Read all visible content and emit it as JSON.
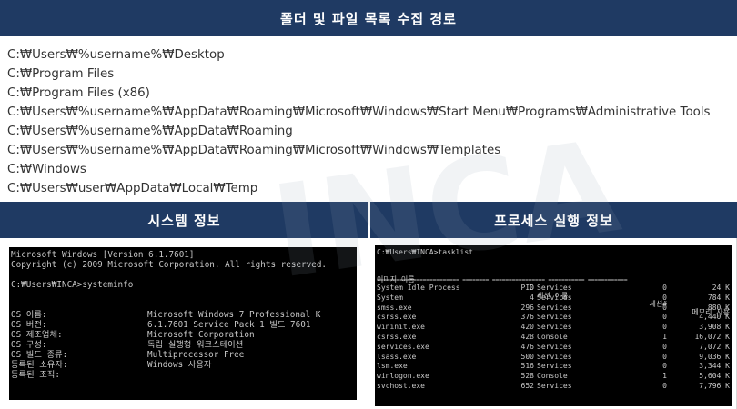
{
  "header": {
    "title": "폴더 및 파일 목록 수집 경로"
  },
  "paths": [
    "C:₩Users₩%username%₩Desktop",
    "C:₩Program Files",
    "C:₩Program Files (x86)",
    "C:₩Users₩%username%₩AppData₩Roaming₩Microsoft₩Windows₩Start Menu₩Programs₩Administrative Tools",
    "C:₩Users₩%username%₩AppData₩Roaming",
    "C:₩Users₩%username%₩AppData₩Roaming₩Microsoft₩Windows₩Templates",
    "C:₩Windows",
    "C:₩Users₩user₩AppData₩Local₩Temp"
  ],
  "system_panel": {
    "title": "시스템 정보",
    "console_lines": [
      "Microsoft Windows [Version 6.1.7601]",
      "Copyright (c) 2009 Microsoft Corporation. All rights reserved.",
      "C:₩Users₩INCA>systeminfo"
    ],
    "rows": [
      {
        "label": "OS 이름:",
        "value": "Microsoft Windows 7 Professional K"
      },
      {
        "label": "OS 버전:",
        "value": "6.1.7601 Service Pack 1 빌드 7601"
      },
      {
        "label": "OS 제조업체:",
        "value": "Microsoft Corporation"
      },
      {
        "label": "OS 구성:",
        "value": "독립 실행형 워크스테이션"
      },
      {
        "label": "OS 빌드 종류:",
        "value": "Multiprocessor Free"
      },
      {
        "label": "등록된 소유자:",
        "value": "Windows 사용자"
      },
      {
        "label": "등록된 조직:",
        "value": ""
      }
    ]
  },
  "process_panel": {
    "title": "프로세스 실행 정보",
    "prompt": "C:₩Users₩INCA>tasklist",
    "columns": {
      "name": "이미지 이름",
      "pid": "PID",
      "session": "세션 이름",
      "session_num": "세션#",
      "mem": "메모리 사용"
    },
    "separator": "========================= ======== ================ =========== ============",
    "processes": [
      {
        "name": "System Idle Process",
        "pid": "0",
        "session": "Services",
        "num": "0",
        "mem": "24 K"
      },
      {
        "name": "System",
        "pid": "4",
        "session": "Services",
        "num": "0",
        "mem": "784 K"
      },
      {
        "name": "smss.exe",
        "pid": "296",
        "session": "Services",
        "num": "0",
        "mem": "880 K"
      },
      {
        "name": "csrss.exe",
        "pid": "376",
        "session": "Services",
        "num": "0",
        "mem": "4,440 K"
      },
      {
        "name": "wininit.exe",
        "pid": "420",
        "session": "Services",
        "num": "0",
        "mem": "3,908 K"
      },
      {
        "name": "csrss.exe",
        "pid": "428",
        "session": "Console",
        "num": "1",
        "mem": "16,072 K"
      },
      {
        "name": "services.exe",
        "pid": "476",
        "session": "Services",
        "num": "0",
        "mem": "7,072 K"
      },
      {
        "name": "lsass.exe",
        "pid": "500",
        "session": "Services",
        "num": "0",
        "mem": "9,036 K"
      },
      {
        "name": "lsm.exe",
        "pid": "516",
        "session": "Services",
        "num": "0",
        "mem": "3,344 K"
      },
      {
        "name": "winlogon.exe",
        "pid": "528",
        "session": "Console",
        "num": "1",
        "mem": "5,604 K"
      },
      {
        "name": "svchost.exe",
        "pid": "652",
        "session": "Services",
        "num": "0",
        "mem": "7,796 K"
      }
    ]
  }
}
